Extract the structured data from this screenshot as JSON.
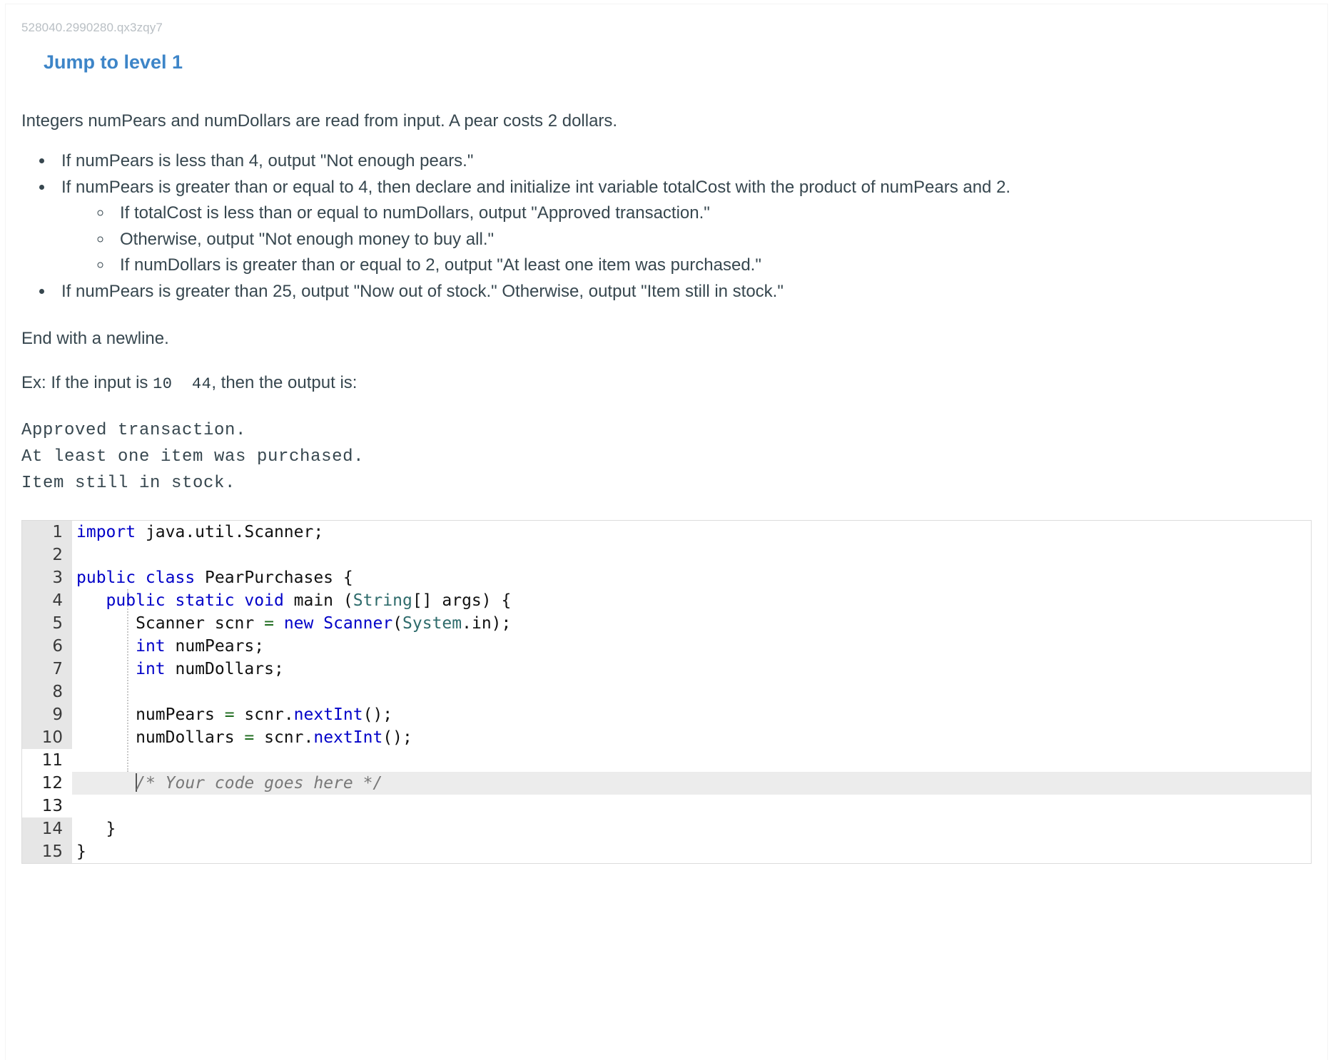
{
  "header": {
    "activity_id": "528040.2990280.qx3zqy7",
    "jump_to_level": "Jump to level 1"
  },
  "problem": {
    "intro": "Integers numPears and numDollars are read from input. A pear costs 2 dollars.",
    "bullets": [
      "If numPears is less than 4, output \"Not enough pears.\"",
      "If numPears is greater than or equal to 4, then declare and initialize int variable totalCost with the product of numPears and 2.",
      "If numPears is greater than 25, output \"Now out of stock.\" Otherwise, output \"Item still in stock.\""
    ],
    "subbullets": [
      "If totalCost is less than or equal to numDollars, output \"Approved transaction.\"",
      "Otherwise, output \"Not enough money to buy all.\"",
      "If numDollars is greater than or equal to 2, output \"At least one item was purchased.\""
    ],
    "newline_note": "End with a newline.",
    "example_prefix": "Ex: If the input is",
    "example_input": "10  44",
    "example_suffix": ", then the output is:",
    "expected_output": "Approved transaction.\nAt least one item was purchased.\nItem still in stock."
  },
  "editor": {
    "filename_class": "PearPurchases",
    "line_numbers": [
      "1",
      "2",
      "3",
      "4",
      "5",
      "6",
      "7",
      "8",
      "9",
      "10",
      "11",
      "12",
      "13",
      "14",
      "15"
    ],
    "editable_lines": [
      11,
      12,
      13
    ],
    "highlighted_line": 12,
    "lines": {
      "1": "import java.util.Scanner;",
      "2": "",
      "3": "public class PearPurchases {",
      "4": "   public static void main (String[] args) {",
      "5": "      Scanner scnr = new Scanner(System.in);",
      "6": "      int numPears;",
      "7": "      int numDollars;",
      "8": "",
      "9": "      numPears = scnr.nextInt();",
      "10": "      numDollars = scnr.nextInt();",
      "11": "",
      "12": "      /* Your code goes here */",
      "13": "",
      "14": "   }",
      "15": "}"
    },
    "colors": {
      "keyword": "#0000c8",
      "type": "#2e6b6b",
      "operator": "#1d6b1d",
      "comment": "#787878",
      "gutter_readonly_bg": "#e6e6e6",
      "gutter_editable_bg": "#ffffff",
      "highlight_bg": "#ececec"
    }
  },
  "theme": {
    "link_blue": "#3d85c8",
    "body_text": "#37474f",
    "muted_text": "#b9bfc4"
  }
}
